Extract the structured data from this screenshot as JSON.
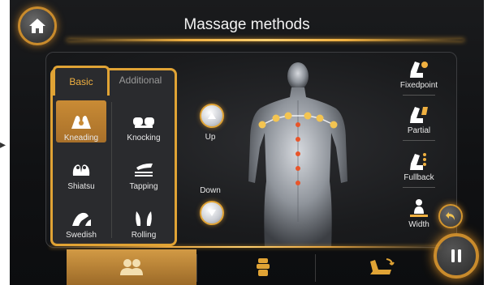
{
  "header": {
    "title": "Massage methods"
  },
  "tabs": [
    {
      "label": "Basic",
      "active": true
    },
    {
      "label": "Additional",
      "active": false
    }
  ],
  "methods": [
    {
      "label": "Kneading",
      "active": true
    },
    {
      "label": "Knocking",
      "active": false
    },
    {
      "label": "Shiatsu",
      "active": false
    },
    {
      "label": "Tapping",
      "active": false
    },
    {
      "label": "Swedish",
      "active": false
    },
    {
      "label": "Rolling",
      "active": false
    }
  ],
  "position": {
    "up_label": "Up",
    "down_label": "Down"
  },
  "modes": [
    {
      "label": "Fixedpoint"
    },
    {
      "label": "Partial"
    },
    {
      "label": "Fullback"
    },
    {
      "label": "Width"
    }
  ],
  "colors": {
    "accent": "#e0a335",
    "active_fill": "#c98b35",
    "point_center": "#e8552a",
    "point_shoulder": "#f3c451"
  },
  "bottom_nav": [
    {
      "icon": "users-icon",
      "active": true
    },
    {
      "icon": "massage-head-icon",
      "active": false
    },
    {
      "icon": "recline-chair-icon",
      "active": false
    }
  ]
}
